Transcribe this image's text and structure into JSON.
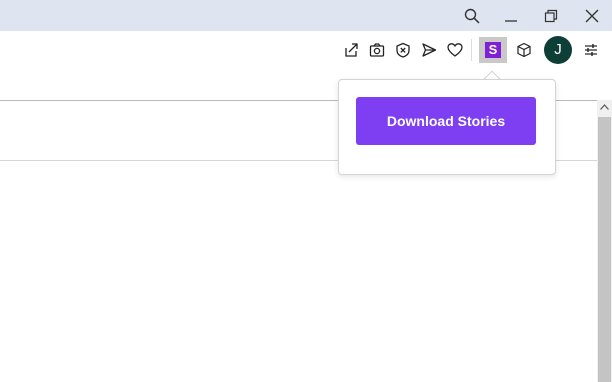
{
  "window_controls": {
    "search": "search-icon",
    "minimize": "minimize-icon",
    "restore": "restore-icon",
    "close": "close-icon"
  },
  "toolbar": {
    "icons": [
      "share-icon",
      "camera-icon",
      "shield-icon",
      "send-icon",
      "heart-icon"
    ],
    "extension": {
      "letter": "S",
      "color": "#7f1fd6"
    },
    "extensions_icon": "cube-icon",
    "profile": {
      "initial": "J",
      "color": "#0e3f36"
    },
    "menu_icon": "sliders-icon"
  },
  "popup": {
    "button_label": "Download Stories",
    "button_color": "#7e3ff2"
  },
  "colors": {
    "titlebar": "#dee5f0",
    "accent": "#7e3ff2"
  }
}
